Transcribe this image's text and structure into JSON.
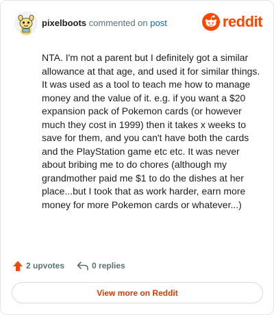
{
  "header": {
    "username": "pixelboots",
    "action_text": "commented on",
    "post_link_text": "post",
    "brand_name": "reddit"
  },
  "comment": {
    "body": "NTA. I'm not a parent but I definitely got a similar allowance at that age, and used it for similar things. It was used as a tool to teach me how to manage money and the value of it. e.g. if you want a $20 expansion pack of Pokemon cards (or however much they cost in 1999) then it takes x weeks to save for them, and you can't have both the cards and the PlayStation game etc etc. It was never about bribing me to do chores (although my grandmother paid me $1 to do the dishes at her place...but I took that as work harder, earn more money for more Pokemon cards or whatever...)"
  },
  "stats": {
    "upvotes": "2 upvotes",
    "replies": "0 replies"
  },
  "footer": {
    "view_more_label": "View more on Reddit"
  },
  "colors": {
    "brand": "#ff4500",
    "link": "#0a5ed6",
    "muted": "#576f76",
    "upvote": "#ff4500",
    "view_more": "#d93a00"
  },
  "icons": {
    "avatar": "snoo-avatar-icon",
    "logo": "reddit-snoo-icon",
    "upvote": "upvote-arrow-icon",
    "reply": "reply-arrow-icon"
  }
}
